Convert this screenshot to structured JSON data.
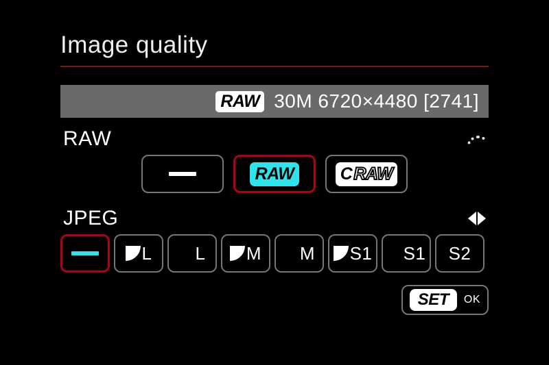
{
  "title": "Image quality",
  "info": {
    "format_badge": "RAW",
    "summary": "30M 6720×4480 [2741]"
  },
  "sections": {
    "raw_label": "RAW",
    "jpeg_label": "JPEG"
  },
  "raw_options": {
    "none": "—",
    "raw": "RAW",
    "craw_prefix": "C",
    "craw_text": "RAW"
  },
  "jpeg_options": [
    {
      "label": ""
    },
    {
      "label": "L"
    },
    {
      "label": "L"
    },
    {
      "label": "M"
    },
    {
      "label": "M"
    },
    {
      "label": "S1"
    },
    {
      "label": "S1"
    },
    {
      "label": "S2"
    }
  ],
  "footer": {
    "set_label": "SET",
    "ok_label": "OK"
  }
}
